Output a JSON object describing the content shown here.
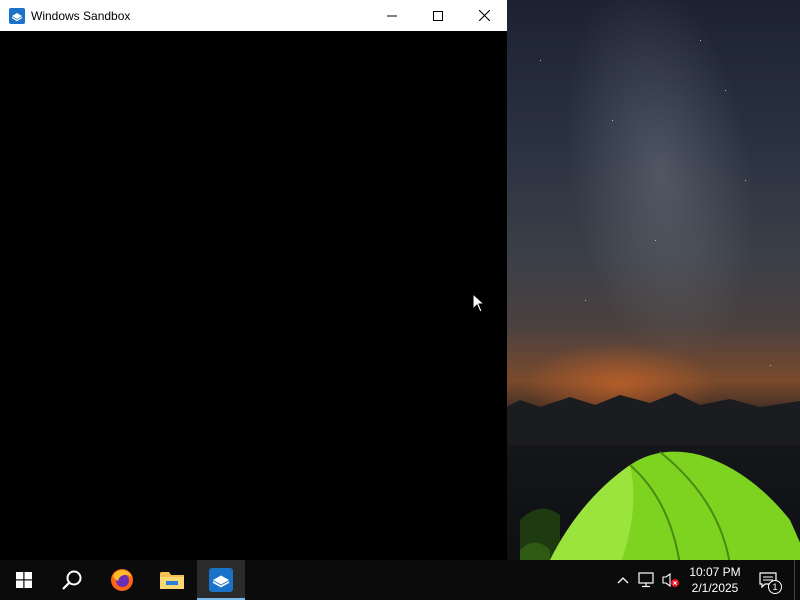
{
  "window": {
    "title": "Windows Sandbox",
    "app_icon": "windows-sandbox-icon",
    "controls": [
      "minimize-icon",
      "maximize-icon",
      "close-icon"
    ]
  },
  "desktop": {
    "wallpaper": "night-sky-with-green-tent"
  },
  "taskbar": {
    "items": [
      {
        "name": "start",
        "icon": "windows-logo-icon"
      },
      {
        "name": "search",
        "icon": "search-icon"
      },
      {
        "name": "firefox",
        "icon": "firefox-icon"
      },
      {
        "name": "file-explorer",
        "icon": "folder-icon"
      },
      {
        "name": "windows-sandbox",
        "icon": "windows-sandbox-icon",
        "active": true
      }
    ],
    "tray": {
      "chevron_icon": "chevron-up-icon",
      "network_icon": "network-icon",
      "volume_icon": "volume-muted-icon",
      "time": "10:07 PM",
      "date": "2/1/2025",
      "notification_icon": "notification-icon",
      "notification_count": "1"
    }
  },
  "colors": {
    "taskbar_bg": "#0b0b0b",
    "active_indicator": "#76b9ed",
    "sandbox_blue": "#1a73c8",
    "tent_green": "#7ed321"
  }
}
